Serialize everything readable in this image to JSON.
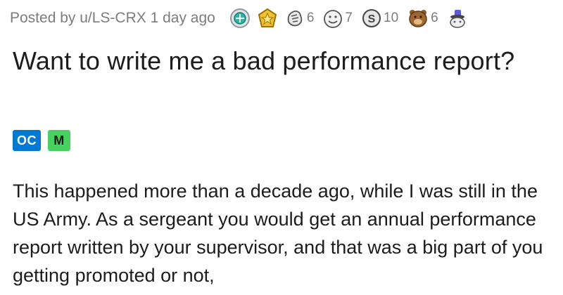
{
  "post": {
    "meta": "Posted by u/LS-CRX 1 day ago",
    "awards": [
      {
        "icon": "silver-medal-icon",
        "count": ""
      },
      {
        "icon": "gold-star-icon",
        "count": ""
      },
      {
        "icon": "hands-award-icon",
        "count": "6"
      },
      {
        "icon": "face-award-icon",
        "count": "7"
      },
      {
        "icon": "coin-award-icon",
        "count": "10"
      },
      {
        "icon": "bear-award-icon",
        "count": "6"
      },
      {
        "icon": "hat-award-icon",
        "count": ""
      }
    ],
    "title": "Want to write me a bad performance report?",
    "flairs": {
      "oc": "OC",
      "m": "M"
    },
    "body": "This happened more than a decade ago, while I was still in the US Army. As a sergeant you would get an annual performance report written by your supervisor, and that was a big part of you getting promoted or not,"
  },
  "colors": {
    "oc_flair": "#0079d3",
    "m_flair": "#46d160",
    "meta_text": "#7c7c7c"
  }
}
